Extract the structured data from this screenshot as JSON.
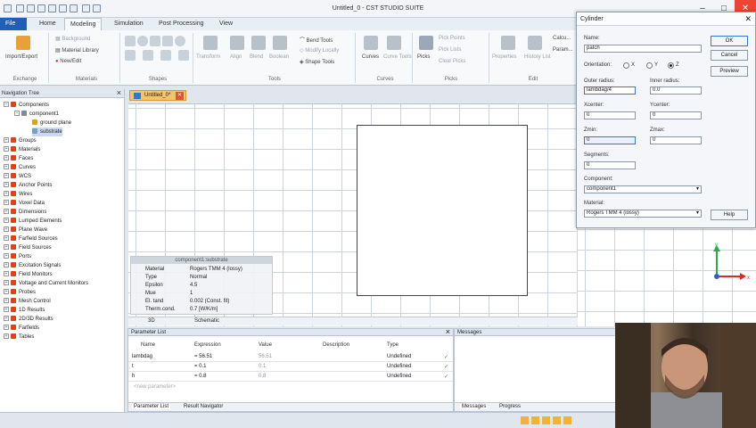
{
  "window": {
    "title": "Untitled_0 - CST STUDIO SUITE"
  },
  "tabs": [
    "File",
    "Home",
    "Modeling",
    "Simulation",
    "Post Processing",
    "View"
  ],
  "active_tab": "Modeling",
  "ribbon": {
    "exchange": {
      "button": "Import/Export",
      "group": "Exchange"
    },
    "materials": {
      "background": "Background",
      "library": "Material Library",
      "new_edit": "New/Edit",
      "group": "Materials"
    },
    "shapes": {
      "group": "Shapes"
    },
    "tools": {
      "transform": "Transform",
      "align": "Align",
      "blend": "Blend",
      "boolean": "Boolean",
      "bend_tools": "Bend Tools",
      "modify_locally": "Modify Locally",
      "shape_tools": "Shape Tools",
      "group": "Tools"
    },
    "curves": {
      "curves": "Curves",
      "curve_tools": "Curve Tools",
      "group": "Curves"
    },
    "picks": {
      "picks": "Picks",
      "pick_points": "Pick Points",
      "pick_lists": "Pick Lists",
      "clear_picks": "Clear Picks",
      "group": "Picks"
    },
    "edit": {
      "properties": "Properties",
      "history_list": "History List",
      "calc": "Calcu...",
      "param": "Param...",
      "group": "Edit"
    }
  },
  "nav": {
    "title": "Navigation Tree",
    "components_root": "Components",
    "component1": "component1",
    "ground_plane": "ground plane",
    "substrate": "substrate",
    "items": [
      "Groups",
      "Materials",
      "Faces",
      "Curves",
      "WCS",
      "Anchor Points",
      "Wires",
      "Voxel Data",
      "Dimensions",
      "Lumped Elements",
      "Plane Wave",
      "Farfield Sources",
      "Field Sources",
      "Ports",
      "Excitation Signals",
      "Field Monitors",
      "Voltage and Current Monitors",
      "Probes",
      "Mesh Control",
      "1D Results",
      "2D/3D Results",
      "Farfields",
      "Tables"
    ]
  },
  "doc_tab": "Untitled_0*",
  "infobox": {
    "title": "component1:substrate",
    "rows": [
      {
        "key": "Material",
        "value": "Rogers TMM 4 (lossy)"
      },
      {
        "key": "Type",
        "value": "Normal"
      },
      {
        "key": "Epsilon",
        "value": "4.5"
      },
      {
        "key": "Mue",
        "value": "1"
      },
      {
        "key": "El. tand",
        "value": "0.002 (Const. fit)"
      },
      {
        "key": "Therm.cond.",
        "value": "0.7 [W/K/m]"
      }
    ]
  },
  "view_tabs": {
    "view3d": "3D",
    "schematic": "Schematic"
  },
  "parameter_list": {
    "title": "Parameter List",
    "columns": [
      "Name",
      "Expression",
      "Value",
      "Description",
      "Type"
    ],
    "rows": [
      {
        "name": "lambdag",
        "expression": "= 56.51",
        "value": "56.51",
        "description": "",
        "type": "Undefined"
      },
      {
        "name": "t",
        "expression": "= 0.1",
        "value": "0.1",
        "description": "",
        "type": "Undefined"
      },
      {
        "name": "h",
        "expression": "= 0.8",
        "value": "0.8",
        "description": "",
        "type": "Undefined"
      }
    ],
    "new_parameter": "<new parameter>",
    "bottom_tabs": [
      "Parameter List",
      "Result Navigator"
    ]
  },
  "messages": {
    "title": "Messages",
    "bottom_tabs": [
      "Messages",
      "Progress"
    ]
  },
  "dialog": {
    "title": "Cylinder",
    "name_label": "Name:",
    "name_value": "patch",
    "orientation_label": "Orientation:",
    "orientation_options": [
      "X",
      "Y",
      "Z"
    ],
    "orientation_selected": "Z",
    "outer_radius_label": "Outer radius:",
    "outer_radius_value": "lambdag/4",
    "inner_radius_label": "Inner radius:",
    "inner_radius_value": "0.0",
    "xcenter_label": "Xcenter:",
    "xcenter_value": "0",
    "ycenter_label": "Ycenter:",
    "ycenter_value": "0",
    "zmin_label": "Zmin:",
    "zmin_value": "0",
    "zmax_label": "Zmax:",
    "zmax_value": "0",
    "segments_label": "Segments:",
    "segments_value": "0",
    "component_label": "Component:",
    "component_value": "component1",
    "material_label": "Material:",
    "material_value": "Rogers TMM 4 (lossy)",
    "ok": "OK",
    "cancel": "Cancel",
    "preview": "Preview",
    "help": "Help"
  },
  "axes": {
    "y": "y",
    "x": "x"
  },
  "colors": {
    "file_tab": "#1f5fb5",
    "doc_tab": "#f4c36a",
    "axis_y": "#2da84a",
    "axis_x": "#d42b2b",
    "tree_folder": "#d9441b"
  }
}
